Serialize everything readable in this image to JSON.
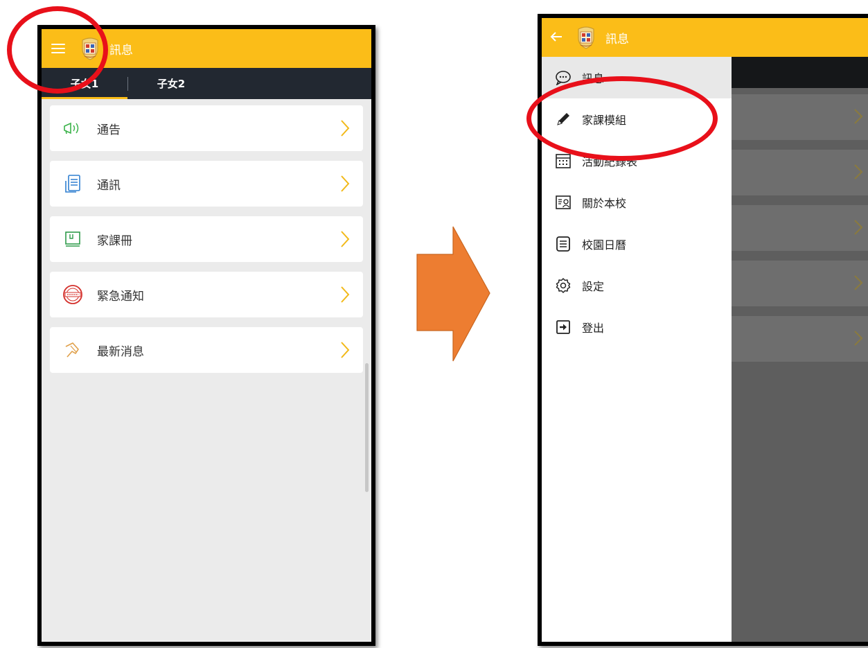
{
  "left_screen": {
    "appbar": {
      "title": "訊息",
      "menu_icon": "hamburger-icon",
      "logo": "school-crest-logo"
    },
    "tabs": [
      {
        "label": "子女1",
        "active": true
      },
      {
        "label": "子女2",
        "active": false
      }
    ],
    "menu_items": [
      {
        "label": "通告",
        "icon": "megaphone-icon"
      },
      {
        "label": "通訊",
        "icon": "newsletter-icon"
      },
      {
        "label": "家課冊",
        "icon": "homework-book-icon"
      },
      {
        "label": "緊急通知",
        "icon": "urgent-stamp-icon"
      },
      {
        "label": "最新消息",
        "icon": "pushpin-icon"
      }
    ]
  },
  "right_screen": {
    "appbar": {
      "title": "訊息",
      "back_icon": "back-arrow-icon",
      "logo": "school-crest-logo"
    },
    "drawer_items": [
      {
        "label": "訊息",
        "icon": "chat-bubble-icon",
        "selected": true
      },
      {
        "label": "家課模組",
        "icon": "pencil-icon",
        "selected": false
      },
      {
        "label": "活動紀錄表",
        "icon": "calendar-grid-icon",
        "selected": false
      },
      {
        "label": "關於本校",
        "icon": "profile-card-icon",
        "selected": false
      },
      {
        "label": "校園日曆",
        "icon": "list-document-icon",
        "selected": false
      },
      {
        "label": "設定",
        "icon": "gear-icon",
        "selected": false
      },
      {
        "label": "登出",
        "icon": "logout-icon",
        "selected": false
      }
    ]
  },
  "colors": {
    "accent": "#fbbd18",
    "tabbar": "#222831",
    "annotation_circle": "#e8101a",
    "arrow": "#ed7d31"
  }
}
